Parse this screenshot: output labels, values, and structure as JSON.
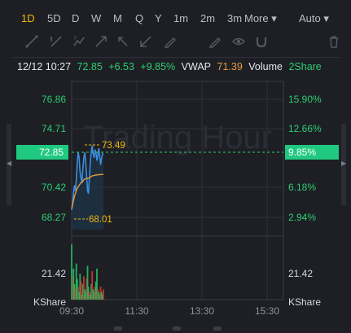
{
  "tabs": [
    {
      "label": "1D",
      "active": true
    },
    {
      "label": "5D"
    },
    {
      "label": "D"
    },
    {
      "label": "W"
    },
    {
      "label": "M"
    },
    {
      "label": "Q"
    },
    {
      "label": "Y"
    },
    {
      "label": "1m"
    },
    {
      "label": "2m"
    },
    {
      "label": "3m"
    },
    {
      "label": "More ▾"
    },
    {
      "label": "Auto ▾"
    }
  ],
  "toolbar_icons": [
    "trend-line-icon",
    "ray-icon",
    "fib-icon",
    "arrow-icon",
    "horizontal-ray-icon",
    "measure-icon",
    "pen-icon",
    "eye-icon",
    "magnet-icon",
    "trash-icon"
  ],
  "quote": {
    "datetime": "12/12 10:27",
    "price": "72.85",
    "change": "+6.53",
    "change_pct": "+9.85%",
    "vwap_label": "VWAP",
    "vwap_value": "71.39",
    "volume_label": "Volume",
    "volume_value": "2Share"
  },
  "watermark": "Trading Hour",
  "chart_data": {
    "type": "line",
    "left_axis_ticks": [
      "76.86",
      "74.71",
      "72.85",
      "70.42",
      "68.27"
    ],
    "right_axis_ticks": [
      "15.90%",
      "12.66%",
      "9.85%",
      "6.18%",
      "2.94%"
    ],
    "current_price_label": "72.85",
    "current_pct_label": "9.85%",
    "high_label": "73.49",
    "low_label": "68.01",
    "volume_axis_left": [
      "21.42",
      "KShare"
    ],
    "volume_axis_right": [
      "21.42",
      "KShare"
    ],
    "x_labels": [
      "09:30",
      "11:30",
      "13:30",
      "15:30"
    ],
    "price_range": [
      68.27,
      76.86
    ],
    "price_series": [
      68.8,
      69.3,
      70.1,
      70.6,
      70.2,
      71.0,
      72.3,
      73.0,
      72.6,
      71.6,
      71.1,
      70.8,
      71.9,
      72.6,
      73.0,
      72.4,
      71.3,
      70.2,
      70.0,
      71.2,
      72.3,
      73.1,
      73.49,
      72.9,
      72.6,
      73.2,
      73.0,
      72.4,
      72.8,
      73.3,
      72.7,
      72.1,
      72.6,
      72.9,
      72.85
    ],
    "vwap_series": [
      68.9,
      69.2,
      69.5,
      69.8,
      70.0,
      70.2,
      70.4,
      70.5,
      70.6,
      70.7,
      70.8,
      70.8,
      70.9,
      71.0,
      71.05,
      71.1,
      71.1,
      71.1,
      71.1,
      71.15,
      71.2,
      71.25,
      71.3,
      71.3,
      71.32,
      71.34,
      71.35,
      71.36,
      71.37,
      71.38,
      71.38,
      71.39,
      71.39,
      71.39,
      71.39
    ],
    "volume_series": [
      21.4,
      9,
      12,
      6,
      4,
      14,
      8,
      5,
      3,
      10,
      7,
      2,
      6,
      9,
      4,
      3,
      8,
      13,
      5,
      3,
      2,
      6,
      11,
      4,
      3,
      5,
      7,
      12,
      4,
      3,
      2,
      5,
      3,
      2,
      4
    ],
    "volume_max": 21.42
  },
  "colors": {
    "up": "#2ecc71",
    "accent": "#f0b90b",
    "line": "#3b8de0",
    "vwap": "#e89b3c",
    "axis_text": "#2ecc71",
    "price_badge": "#20c980"
  }
}
